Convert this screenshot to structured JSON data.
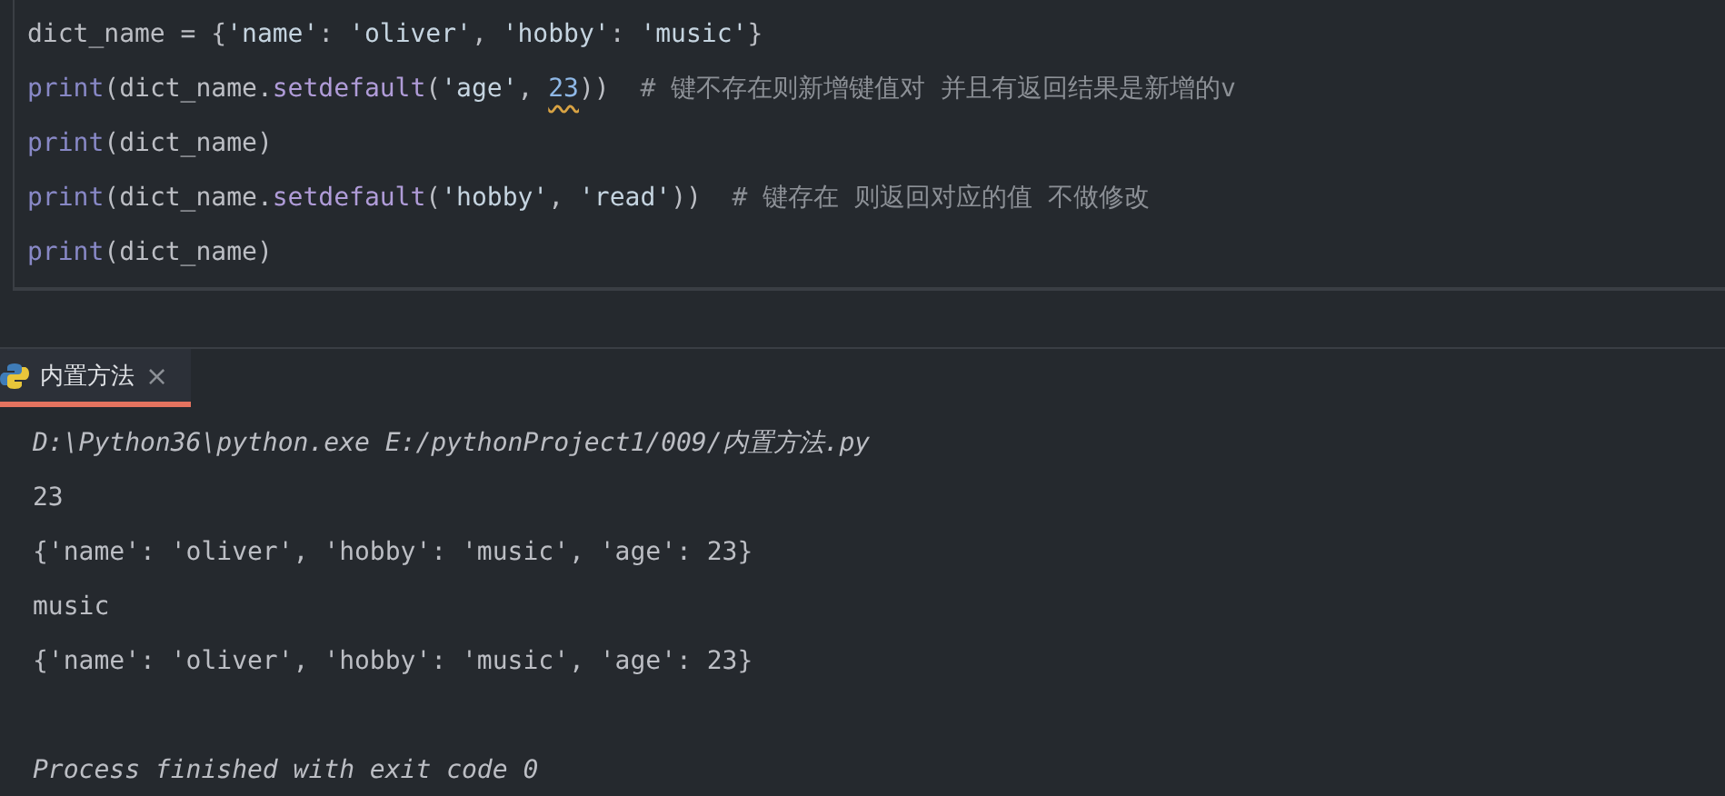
{
  "editor": {
    "lines": [
      [
        {
          "kind": "text",
          "text": "dict_name "
        },
        {
          "kind": "op",
          "text": "="
        },
        {
          "kind": "text",
          "text": " {"
        },
        {
          "kind": "string",
          "text": "'name'"
        },
        {
          "kind": "op",
          "text": ": "
        },
        {
          "kind": "string",
          "text": "'oliver'"
        },
        {
          "kind": "text",
          "text": ", "
        },
        {
          "kind": "string",
          "text": "'hobby'"
        },
        {
          "kind": "op",
          "text": ": "
        },
        {
          "kind": "string",
          "text": "'music'"
        },
        {
          "kind": "text",
          "text": "}"
        }
      ],
      [
        {
          "kind": "builtin",
          "text": "print"
        },
        {
          "kind": "text",
          "text": "(dict_name."
        },
        {
          "kind": "method",
          "text": "setdefault"
        },
        {
          "kind": "text",
          "text": "("
        },
        {
          "kind": "string",
          "text": "'age'"
        },
        {
          "kind": "text",
          "text": ", "
        },
        {
          "kind": "flagged_number",
          "text": "23"
        },
        {
          "kind": "text",
          "text": "))  "
        },
        {
          "kind": "comment",
          "text": "# 键不存在则新增键值对 并且有返回结果是新增的v"
        }
      ],
      [
        {
          "kind": "builtin",
          "text": "print"
        },
        {
          "kind": "text",
          "text": "(dict_name)"
        }
      ],
      [
        {
          "kind": "builtin",
          "text": "print"
        },
        {
          "kind": "text",
          "text": "(dict_name."
        },
        {
          "kind": "method",
          "text": "setdefault"
        },
        {
          "kind": "text",
          "text": "("
        },
        {
          "kind": "string",
          "text": "'hobby'"
        },
        {
          "kind": "text",
          "text": ", "
        },
        {
          "kind": "string",
          "text": "'read'"
        },
        {
          "kind": "text",
          "text": "))  "
        },
        {
          "kind": "comment",
          "text": "# 键存在 则返回对应的值 不做修改"
        }
      ],
      [
        {
          "kind": "builtin",
          "text": "print"
        },
        {
          "kind": "text",
          "text": "(dict_name)"
        }
      ]
    ]
  },
  "run_tabs": [
    {
      "label": "内置方法",
      "close": "×",
      "selected": true
    }
  ],
  "console": [
    {
      "kind": "command",
      "text": "D:\\Python36\\python.exe E:/pythonProject1/009/内置方法.py"
    },
    {
      "kind": "output",
      "text": "23"
    },
    {
      "kind": "output",
      "text": "{'name': 'oliver', 'hobby': 'music', 'age': 23}"
    },
    {
      "kind": "output",
      "text": "music"
    },
    {
      "kind": "output",
      "text": "{'name': 'oliver', 'hobby': 'music', 'age': 23}"
    },
    {
      "kind": "blank"
    },
    {
      "kind": "exit",
      "text": "Process finished with exit code 0"
    }
  ]
}
